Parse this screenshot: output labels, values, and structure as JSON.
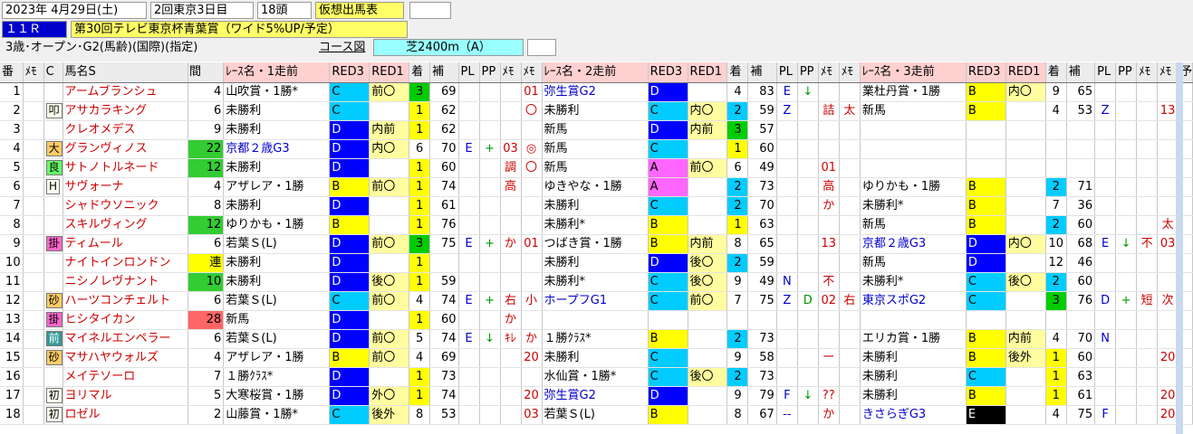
{
  "header": {
    "date": "2023年 4月29日(土)",
    "meet": "2回東京3日目",
    "heads": "18頭",
    "mode": "仮想出馬表",
    "race_no": "１１Ｒ",
    "race_name": "第30回テレビ東京杯青葉賞（ワイド5%UP/予定）",
    "conditions": "3歳･オープン･G2(馬齢)(国際)(指定)",
    "course_label": "コース図",
    "course": "芝2400m（A）"
  },
  "columns": [
    "番",
    "ﾒﾓ",
    "C",
    "馬名S",
    "",
    "間",
    "ﾚｰｽ名・1走前",
    "RED3",
    "RED1",
    "着",
    "補",
    "PL",
    "PP",
    "ﾒﾓ",
    "ﾒﾓ",
    "ﾚｰｽ名・2走前",
    "RED3",
    "RED1",
    "着",
    "補",
    "PL",
    "PP",
    "ﾒﾓ",
    "ﾒﾓ",
    "ﾚｰｽ名・3走前",
    "RED3",
    "RED1",
    "着",
    "補",
    "PL",
    "PP",
    "ﾒﾓ",
    "ﾒﾓ",
    "予"
  ],
  "colors": {
    "A": "#ff66ff",
    "B": "#ffff00",
    "C": "#00ccff",
    "D": "#0000ff",
    "E": "#000000",
    "pos_lead": "#00cc00",
    "pos_sec": "#ffff00",
    "pos_third": "#ff99cc"
  },
  "rows": [
    {
      "n": "1",
      "m": "",
      "c": "",
      "name": "アームブランシュ",
      "gap": "4",
      "r1": [
        "山吹賞・1勝*",
        "C",
        "前〇",
        "3",
        "69",
        "",
        "",
        "",
        "01"
      ],
      "r2": [
        "弥生賞G2",
        "D",
        "",
        "4",
        "83",
        "E",
        "↓",
        "",
        ""
      ],
      "r3": [
        "業杜丹賞・1勝",
        "B",
        "内〇",
        "9",
        "65",
        "",
        "",
        "",
        ""
      ]
    },
    {
      "n": "2",
      "m": "",
      "c": "叩",
      "name": "アサカラキング",
      "gap": "6",
      "r1": [
        "未勝利",
        "C",
        "",
        "1",
        "62",
        "",
        "",
        "",
        "〇"
      ],
      "r2": [
        "未勝利",
        "C",
        "内〇",
        "2",
        "59",
        "Z",
        "",
        "詰",
        "太"
      ],
      "r3": [
        "新馬",
        "B",
        "",
        "4",
        "53",
        "Z",
        "",
        "",
        "13"
      ]
    },
    {
      "n": "3",
      "m": "",
      "c": "",
      "name": "クレオメデス",
      "gap": "9",
      "r1": [
        "未勝利",
        "D",
        "内前",
        "1",
        "62",
        "",
        "",
        "",
        ""
      ],
      "r2": [
        "新馬",
        "D",
        "内前",
        "3",
        "57",
        "",
        "",
        "",
        ""
      ],
      "r3": [
        "",
        "",
        "",
        "",
        "",
        "",
        "",
        "",
        ""
      ]
    },
    {
      "n": "4",
      "m": "",
      "c": "大",
      "name": "グランヴィノス",
      "gap": "22",
      "r1": [
        "京都２歳G3",
        "D",
        "内〇",
        "6",
        "70",
        "E",
        "+",
        "03",
        "◎"
      ],
      "r2": [
        "新馬",
        "C",
        "",
        "1",
        "60",
        "",
        "",
        "",
        ""
      ],
      "r3": [
        "",
        "",
        "",
        "",
        "",
        "",
        "",
        "",
        ""
      ]
    },
    {
      "n": "5",
      "m": "",
      "c": "良",
      "name": "サトノトルネード",
      "gap": "12",
      "r1": [
        "未勝利",
        "D",
        "",
        "1",
        "60",
        "",
        "",
        "調",
        "〇"
      ],
      "r2": [
        "新馬",
        "A",
        "前〇",
        "6",
        "49",
        "",
        "",
        "01",
        ""
      ],
      "r3": [
        "",
        "",
        "",
        "",
        "",
        "",
        "",
        "",
        ""
      ]
    },
    {
      "n": "6",
      "m": "",
      "c": "H",
      "name": "サヴォーナ",
      "gap": "4",
      "r1": [
        "アザレア・1勝",
        "B",
        "前〇",
        "1",
        "74",
        "",
        "",
        "高",
        ""
      ],
      "r2": [
        "ゆきやな・1勝",
        "A",
        "",
        "2",
        "73",
        "",
        "",
        "高",
        ""
      ],
      "r3": [
        "ゆりかも・1勝",
        "B",
        "",
        "2",
        "71",
        "",
        "",
        "",
        ""
      ]
    },
    {
      "n": "7",
      "m": "",
      "c": "",
      "name": "シャドウソニック",
      "gap": "8",
      "r1": [
        "未勝利",
        "D",
        "",
        "1",
        "61",
        "",
        "",
        "",
        ""
      ],
      "r2": [
        "未勝利",
        "C",
        "",
        "2",
        "70",
        "",
        "",
        "か",
        ""
      ],
      "r3": [
        "未勝利*",
        "B",
        "",
        "7",
        "36",
        "",
        "",
        "",
        ""
      ]
    },
    {
      "n": "8",
      "m": "",
      "c": "",
      "name": "スキルヴィング",
      "gap": "12",
      "r1": [
        "ゆりかも・1勝",
        "B",
        "",
        "1",
        "76",
        "",
        "",
        "",
        ""
      ],
      "r2": [
        "未勝利*",
        "B",
        "",
        "1",
        "63",
        "",
        "",
        "",
        ""
      ],
      "r3": [
        "新馬",
        "B",
        "",
        "2",
        "60",
        "",
        "",
        "",
        "太"
      ]
    },
    {
      "n": "9",
      "m": "",
      "c": "掛",
      "name": "ティムール",
      "gap": "6",
      "r1": [
        "若葉Ｓ(L)",
        "D",
        "前〇",
        "3",
        "75",
        "E",
        "+",
        "か",
        "01"
      ],
      "r2": [
        "つばき賞・1勝",
        "B",
        "内前",
        "8",
        "65",
        "",
        "",
        "13",
        ""
      ],
      "r3": [
        "京都２歳G3",
        "D",
        "内〇",
        "10",
        "68",
        "E",
        "↓",
        "不",
        "03"
      ]
    },
    {
      "n": "10",
      "m": "",
      "c": "",
      "name": "ナイトインロンドン",
      "gap": "連",
      "r1": [
        "未勝利",
        "D",
        "",
        "1",
        "",
        "",
        "",
        "",
        ""
      ],
      "r2": [
        "未勝利",
        "D",
        "後〇",
        "2",
        "59",
        "",
        "",
        "",
        ""
      ],
      "r3": [
        "新馬",
        "D",
        "",
        "12",
        "46",
        "",
        "",
        "",
        ""
      ]
    },
    {
      "n": "11",
      "m": "",
      "c": "",
      "name": "ニシノレヴナント",
      "gap": "10",
      "r1": [
        "未勝利",
        "D",
        "後〇",
        "1",
        "59",
        "",
        "",
        "",
        ""
      ],
      "r2": [
        "未勝利*",
        "C",
        "後〇",
        "9",
        "49",
        "N",
        "",
        "不",
        ""
      ],
      "r3": [
        "未勝利*",
        "C",
        "後〇",
        "2",
        "60",
        "",
        "",
        "",
        ""
      ]
    },
    {
      "n": "12",
      "m": "",
      "c": "砂",
      "name": "ハーツコンチェルト",
      "gap": "6",
      "r1": [
        "若葉Ｓ(L)",
        "C",
        "前〇",
        "4",
        "74",
        "E",
        "+",
        "右",
        "小"
      ],
      "r2": [
        "ホープフG1",
        "C",
        "前〇",
        "7",
        "75",
        "Z",
        "D",
        "02",
        "右"
      ],
      "r3": [
        "東京スポG2",
        "C",
        "",
        "3",
        "76",
        "D",
        "+",
        "短",
        "次"
      ]
    },
    {
      "n": "13",
      "m": "",
      "c": "掛",
      "name": "ヒシタイカン",
      "gap": "28",
      "r1": [
        "新馬",
        "D",
        "",
        "1",
        "60",
        "",
        "",
        "か",
        ""
      ],
      "r2": [
        "",
        "",
        "",
        "",
        "",
        "",
        "",
        "",
        ""
      ],
      "r3": [
        "",
        "",
        "",
        "",
        "",
        "",
        "",
        "",
        ""
      ]
    },
    {
      "n": "14",
      "m": "",
      "c": "前",
      "name": "マイネルエンペラー",
      "gap": "6",
      "r1": [
        "若葉Ｓ(L)",
        "D",
        "前〇",
        "5",
        "74",
        "E",
        "↓",
        "ｷﾚ",
        "か"
      ],
      "r2": [
        "１勝ｸﾗｽ*",
        "B",
        "",
        "2",
        "73",
        "",
        "",
        "",
        ""
      ],
      "r3": [
        "エリカ賞・1勝",
        "B",
        "内前",
        "4",
        "70",
        "N",
        "",
        "",
        ""
      ]
    },
    {
      "n": "15",
      "m": "",
      "c": "砂",
      "name": "マサハヤウォルズ",
      "gap": "4",
      "r1": [
        "アザレア・1勝",
        "B",
        "前〇",
        "4",
        "69",
        "",
        "",
        "",
        "20"
      ],
      "r2": [
        "未勝利",
        "C",
        "",
        "9",
        "58",
        "",
        "",
        "ー",
        ""
      ],
      "r3": [
        "未勝利",
        "B",
        "後外",
        "1",
        "60",
        "",
        "",
        "",
        "20"
      ]
    },
    {
      "n": "16",
      "m": "",
      "c": "",
      "name": "メイテソーロ",
      "gap": "7",
      "r1": [
        "１勝ｸﾗｽ*",
        "D",
        "",
        "1",
        "73",
        "",
        "",
        "",
        ""
      ],
      "r2": [
        "水仙賞・1勝*",
        "C",
        "後〇",
        "2",
        "73",
        "",
        "",
        "",
        ""
      ],
      "r3": [
        "未勝利",
        "C",
        "",
        "1",
        "63",
        "",
        "",
        "",
        ""
      ]
    },
    {
      "n": "17",
      "m": "",
      "c": "初",
      "name": "ヨリマル",
      "gap": "5",
      "r1": [
        "大寒桜賞・1勝",
        "D",
        "外〇",
        "1",
        "74",
        "",
        "",
        "",
        "20"
      ],
      "r2": [
        "弥生賞G2",
        "D",
        "",
        "9",
        "79",
        "F",
        "↓",
        "??",
        ""
      ],
      "r3": [
        "未勝利",
        "B",
        "",
        "1",
        "61",
        "",
        "",
        "",
        "20"
      ]
    },
    {
      "n": "18",
      "m": "",
      "c": "初",
      "name": "ロゼル",
      "gap": "2",
      "r1": [
        "山藤賞・1勝*",
        "C",
        "後外",
        "8",
        "53",
        "",
        "",
        "",
        "03"
      ],
      "r2": [
        "若葉Ｓ(L)",
        "B",
        "",
        "8",
        "67",
        "--",
        "",
        "か",
        ""
      ],
      "r3": [
        "きさらぎG3",
        "E",
        "",
        "4",
        "75",
        "F",
        "",
        "",
        "20"
      ]
    }
  ]
}
